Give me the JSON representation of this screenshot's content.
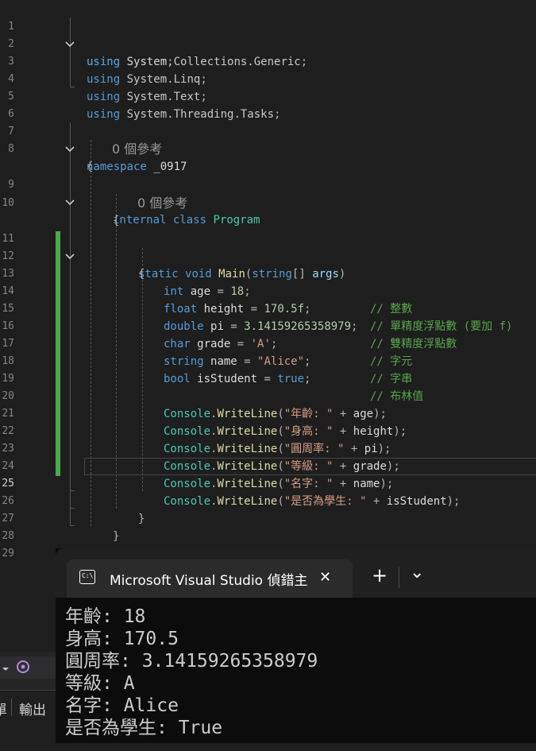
{
  "editor": {
    "line_numbers": [
      "1",
      "2",
      "3",
      "4",
      "5",
      "6",
      "7",
      "8",
      "9",
      "10",
      "11",
      "12",
      "13",
      "14",
      "15",
      "16",
      "17",
      "18",
      "19",
      "20",
      "21",
      "22",
      "23",
      "24",
      "25",
      "26",
      "27",
      "28",
      "29"
    ],
    "usings": {
      "keyword": "using",
      "namespaces": [
        "System",
        "System.Collections.Generic",
        "System.Linq",
        "System.Text",
        "System.Threading.Tasks"
      ]
    },
    "namespace": {
      "keyword": "namespace",
      "name": "_0917"
    },
    "code_lens": [
      "0 個參考",
      "0 個參考"
    ],
    "class_decl": {
      "modifier": "internal",
      "keyword": "class",
      "name": "Program"
    },
    "method_decl": {
      "modifier": "static",
      "return_type": "void",
      "name": "Main",
      "param_type": "string",
      "param_name": "args"
    },
    "variables": [
      {
        "type": "int",
        "name": "age",
        "value": "18",
        "comment": "// 整數"
      },
      {
        "type": "float",
        "name": "height",
        "value": "170.5f",
        "comment": "// 單精度浮點數 (要加 f)"
      },
      {
        "type": "double",
        "name": "pi",
        "value": "3.14159265358979",
        "comment": "// 雙精度浮點數"
      },
      {
        "type": "char",
        "name": "grade",
        "value": "'A'",
        "comment": "// 字元"
      },
      {
        "type": "string",
        "name": "name",
        "value": "\"Alice\"",
        "comment": "// 字串"
      },
      {
        "type": "bool",
        "name": "isStudent",
        "value": "true",
        "comment": "// 布林值"
      }
    ],
    "writelines": [
      {
        "label": "\"年齡: \"",
        "var": "age"
      },
      {
        "label": "\"身高: \"",
        "var": "height"
      },
      {
        "label": "\"圓周率: \"",
        "var": "pi"
      },
      {
        "label": "\"等級: \"",
        "var": "grade"
      },
      {
        "label": "\"名字: \"",
        "var": "name"
      },
      {
        "label": "\"是否為學生: \"",
        "var": "isStudent"
      }
    ],
    "console_class": "Console",
    "writeline_method": "WriteLine"
  },
  "console_window": {
    "tab_title": "Microsoft Visual Studio 偵錯主",
    "close_glyph": "✕",
    "new_tab_glyph": "+",
    "dropdown_glyph": "⌄",
    "icon_text": "C:\\",
    "output_lines": [
      "年齡: 18",
      "身高: 170.5",
      "圓周率: 3.14159265358979",
      "等級: A",
      "名字: Alice",
      "是否為學生: True"
    ]
  },
  "left_panel": {
    "tab_partial_left": "單",
    "tab_output": "輸出"
  },
  "colors": {
    "editor_bg": "#1e1e1e",
    "keyword": "#569cd6",
    "type": "#4ec9b0",
    "string": "#d69d85",
    "comment": "#57a64a",
    "number": "#b5cea8",
    "method": "#dcdcaa",
    "change_bar": "#4ca84c",
    "console_bg": "#0c0c0c"
  }
}
